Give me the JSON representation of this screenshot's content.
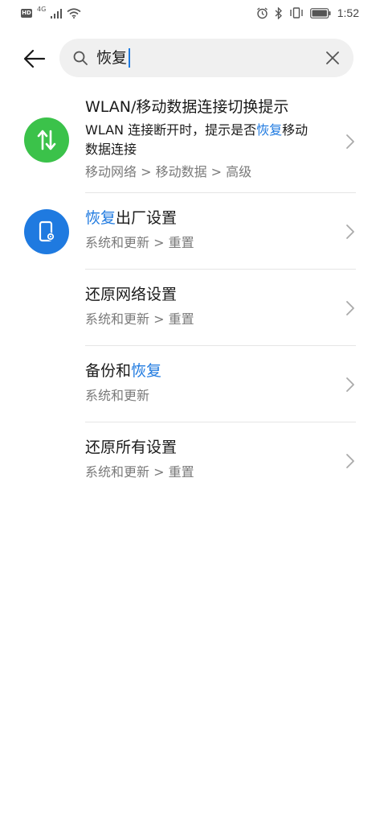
{
  "status_bar": {
    "hd": "HD",
    "network": "4G",
    "time": "1:52"
  },
  "search": {
    "query": "恢复"
  },
  "results": [
    {
      "title": "WLAN/移动数据连接切换提示",
      "desc_pre": "WLAN 连接断开时，提示是否",
      "desc_hl": "恢复",
      "desc_post": "移动",
      "desc_line2": "数据连接",
      "path": "移动网络 > 移动数据 > 高级",
      "icon": "data-switch-icon",
      "icon_color": "#3bc24a"
    },
    {
      "title_hl": "恢复",
      "title_post": "出厂设置",
      "path": "系统和更新 > 重置",
      "icon": "phone-settings-icon",
      "icon_color": "#1f7ae0"
    },
    {
      "title": "还原网络设置",
      "path": "系统和更新 > 重置"
    },
    {
      "title_pre": "备份和",
      "title_hl": "恢复",
      "path": "系统和更新"
    },
    {
      "title": "还原所有设置",
      "path": "系统和更新 > 重置"
    }
  ],
  "colors": {
    "highlight": "#1f7ae0",
    "divider": "#e5e5e5",
    "search_bg": "#f0f0f0"
  }
}
